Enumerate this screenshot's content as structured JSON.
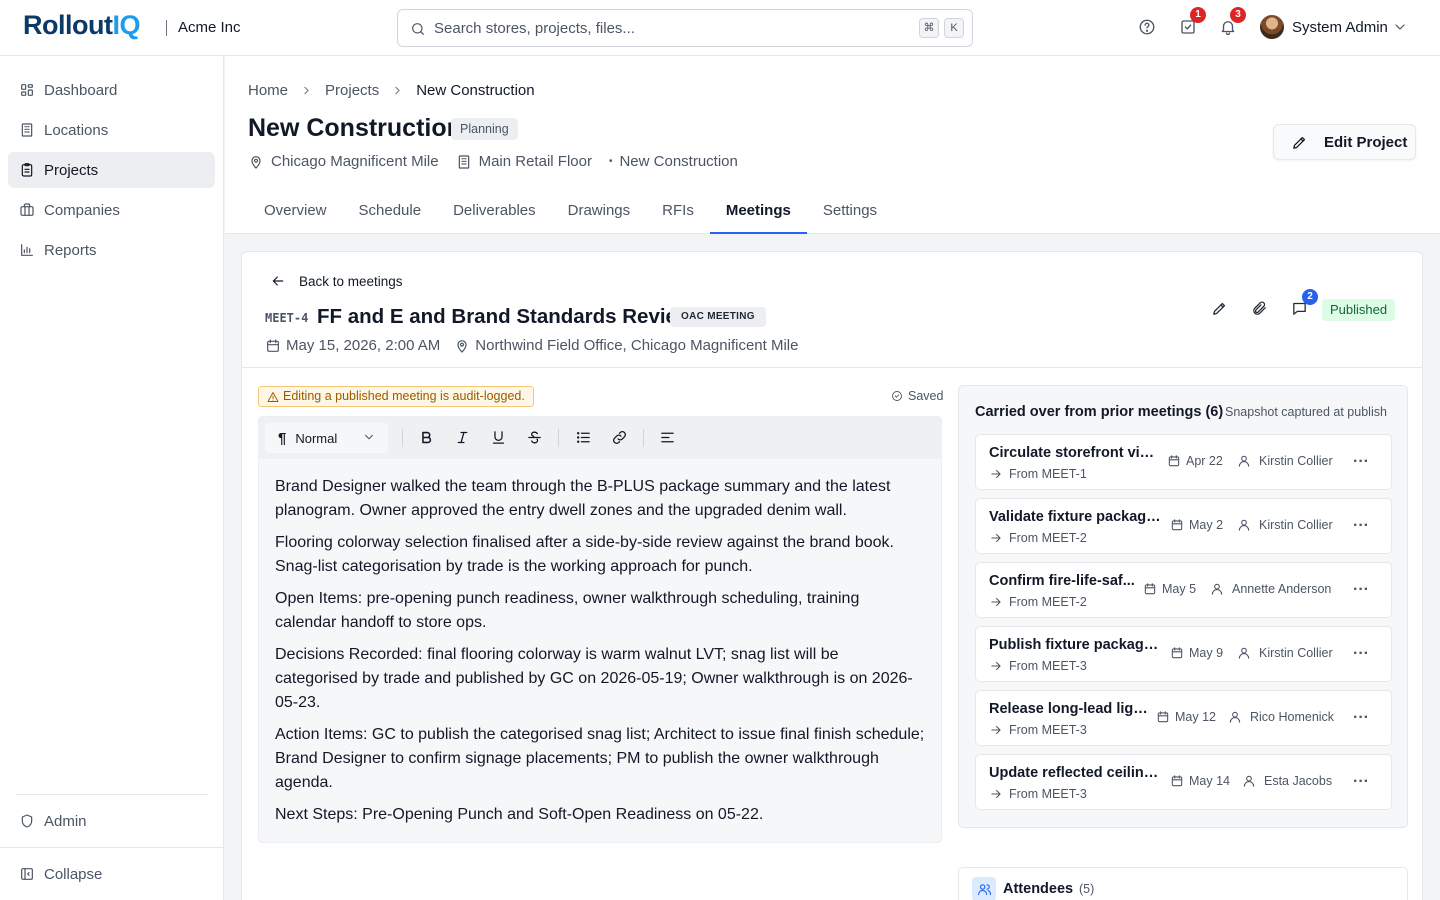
{
  "app": {
    "logo_main": "Rollout",
    "logo_accent": "IQ",
    "org_name": "Acme Inc",
    "search_placeholder": "Search stores, projects, files...",
    "search_kbd": [
      "⌘",
      "K"
    ],
    "tasks_badge": "1",
    "notifications_badge": "3",
    "user_name": "System Admin"
  },
  "sidebar": {
    "items": [
      {
        "label": "Dashboard",
        "icon": "dashboard-icon"
      },
      {
        "label": "Locations",
        "icon": "building-icon"
      },
      {
        "label": "Projects",
        "icon": "clipboard-icon",
        "active": true
      },
      {
        "label": "Companies",
        "icon": "briefcase-icon"
      },
      {
        "label": "Reports",
        "icon": "bar-chart-icon"
      }
    ],
    "admin_label": "Admin",
    "collapse_label": "Collapse"
  },
  "project": {
    "breadcrumbs": [
      "Home",
      "Projects",
      "New Construction"
    ],
    "title": "New Construction",
    "status": "Planning",
    "location": "Chicago Magnificent Mile",
    "floor": "Main Retail Floor",
    "type": "New Construction",
    "edit_label": "Edit Project",
    "tabs": [
      "Overview",
      "Schedule",
      "Deliverables",
      "Drawings",
      "RFIs",
      "Meetings",
      "Settings"
    ],
    "active_tab": "Meetings"
  },
  "meeting": {
    "back_label": "Back to meetings",
    "code": "MEET-4",
    "title": "FF and E and Brand Standards Review",
    "type": "OAC MEETING",
    "datetime": "May 15, 2026, 2:00 AM",
    "location": "Northwind Field Office, Chicago Magnificent Mile",
    "comments_count": "2",
    "status": "Published",
    "warning": "Editing a published meeting is audit-logged.",
    "saved_label": "Saved",
    "format_value": "Normal",
    "notes": [
      "Brand Designer walked the team through the B-PLUS package summary and the latest planogram. Owner approved the entry dwell zones and the upgraded denim wall.",
      "Flooring colorway selection finalised after a side-by-side review against the brand book. Snag-list categorisation by trade is the working approach for punch.",
      "Open Items: pre-opening punch readiness, owner walkthrough scheduling, training calendar handoff to store ops.",
      "Decisions Recorded: final flooring colorway is warm walnut LVT; snag list will be categorised by trade and published by GC on 2026-05-19; Owner walkthrough is on 2026-05-23.",
      "Action Items: GC to publish the categorised snag list; Architect to issue final finish schedule; Brand Designer to confirm signage placements; PM to publish the owner walkthrough agenda.",
      "Next Steps: Pre-Opening Punch and Soft-Open Readiness on 05-22."
    ]
  },
  "carried": {
    "title": "Carried over from prior meetings (6)",
    "subtitle": "Snapshot captured at publish",
    "items": [
      {
        "title": "Circulate storefront vin...",
        "from": "From MEET-1",
        "date": "Apr 22",
        "owner": "Kirstin Collier"
      },
      {
        "title": "Validate fixture package...",
        "from": "From MEET-2",
        "date": "May 2",
        "owner": "Kirstin Collier"
      },
      {
        "title": "Confirm fire-life-saf...",
        "from": "From MEET-2",
        "date": "May 5",
        "owner": "Annette Anderson"
      },
      {
        "title": "Publish fixture package ...",
        "from": "From MEET-3",
        "date": "May 9",
        "owner": "Kirstin Collier"
      },
      {
        "title": "Release long-lead ligh...",
        "from": "From MEET-3",
        "date": "May 12",
        "owner": "Rico Homenick"
      },
      {
        "title": "Update reflected ceiling ...",
        "from": "From MEET-3",
        "date": "May 14",
        "owner": "Esta Jacobs"
      }
    ]
  },
  "attendees": {
    "title": "Attendees",
    "count": "(5)"
  }
}
